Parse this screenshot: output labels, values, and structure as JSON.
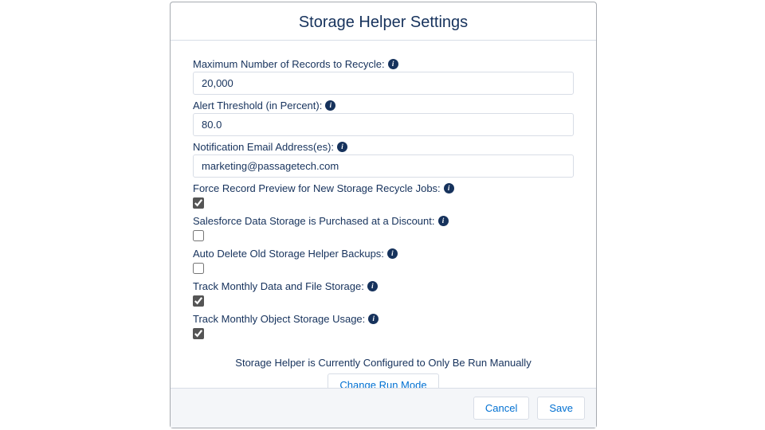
{
  "modal": {
    "title": "Storage Helper Settings"
  },
  "fields": {
    "max_records": {
      "label": "Maximum Number of Records to Recycle:",
      "value": "20,000"
    },
    "alert_threshold": {
      "label": "Alert Threshold (in Percent):",
      "value": "80.0"
    },
    "notification_emails": {
      "label": "Notification Email Address(es):",
      "value": "marketing@passagetech.com"
    },
    "force_preview": {
      "label": "Force Record Preview for New Storage Recycle Jobs:",
      "checked": true
    },
    "discount_storage": {
      "label": "Salesforce Data Storage is Purchased at a Discount:",
      "checked": false
    },
    "auto_delete_backups": {
      "label": "Auto Delete Old Storage Helper Backups:",
      "checked": false
    },
    "track_monthly_data": {
      "label": "Track Monthly Data and File Storage:",
      "checked": true
    },
    "track_monthly_object": {
      "label": "Track Monthly Object Storage Usage:",
      "checked": true
    }
  },
  "status_text": "Storage Helper is Currently Configured to Only Be Run Manually",
  "buttons": {
    "change_run_mode": "Change Run Mode",
    "cancel": "Cancel",
    "save": "Save"
  },
  "info_glyph": "i"
}
